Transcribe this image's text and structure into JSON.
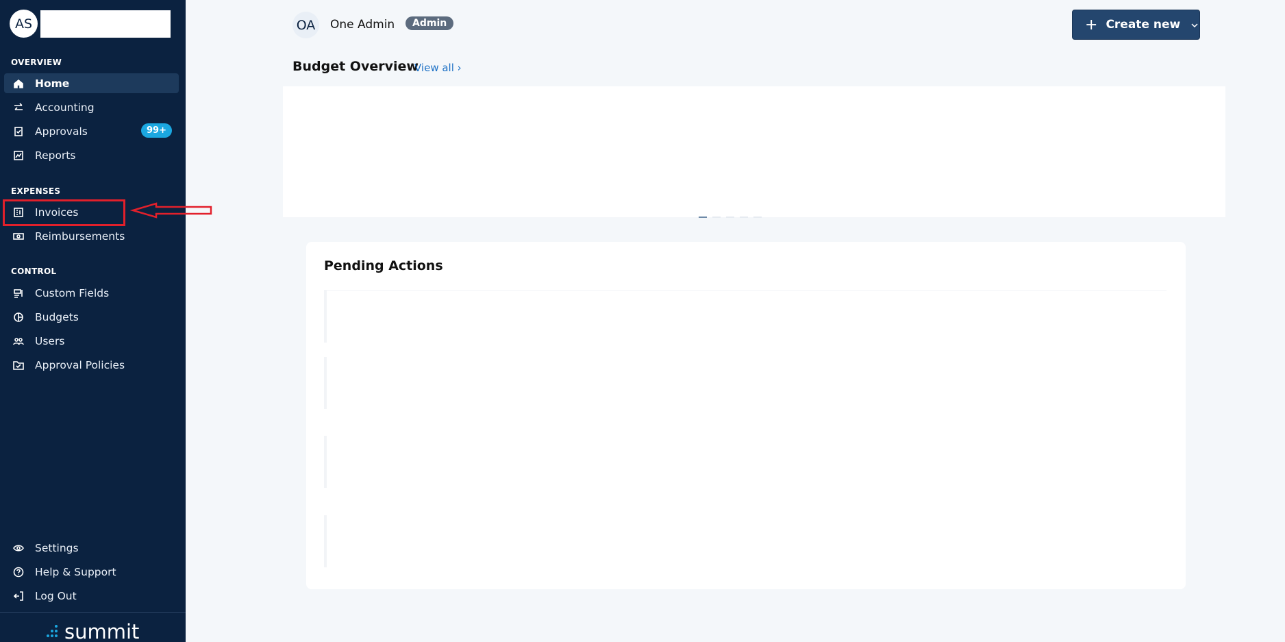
{
  "sidebar": {
    "avatar_initials": "AS",
    "sections": {
      "overview": "OVERVIEW",
      "expenses": "EXPENSES",
      "control": "CONTROL"
    },
    "items": {
      "home": "Home",
      "accounting": "Accounting",
      "approvals": "Approvals",
      "approvals_badge": "99+",
      "reports": "Reports",
      "invoices": "Invoices",
      "reimbursements": "Reimbursements",
      "custom_fields": "Custom Fields",
      "budgets": "Budgets",
      "users": "Users",
      "approval_policies": "Approval Policies",
      "settings": "Settings",
      "help": "Help & Support",
      "logout": "Log Out"
    },
    "logo_text": "summit"
  },
  "header": {
    "user_initials": "OA",
    "user_name": "One Admin",
    "role": "Admin",
    "create_label": "Create new"
  },
  "budget": {
    "title": "Budget Overview",
    "view_all": "View all ›"
  },
  "pending": {
    "title": "Pending Actions"
  },
  "colors": {
    "sidebar_bg": "#0b2240",
    "accent": "#1ba7e0",
    "button_bg": "#24466e",
    "annotation": "#e2202b"
  }
}
